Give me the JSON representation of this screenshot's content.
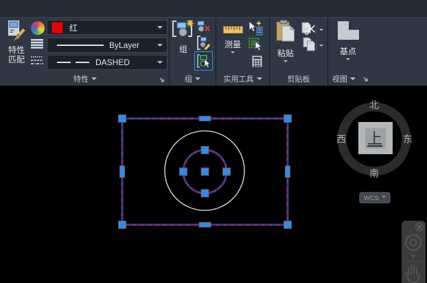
{
  "ribbon": {
    "properties_panel": {
      "label": "特性",
      "match_line1": "特性",
      "match_line2": "匹配",
      "color_value": "红",
      "lineweight_value": "ByLayer",
      "linetype_value": "DASHED"
    },
    "group_panel": {
      "label": "组",
      "group_button": "组"
    },
    "utilities_panel": {
      "label": "实用工具",
      "measure_button": "测量"
    },
    "clipboard_panel": {
      "label": "剪贴板",
      "paste_button": "粘贴"
    },
    "view_panel": {
      "label": "视图",
      "basepoint_button": "基点"
    }
  },
  "canvas": {
    "viewcube": {
      "north": "北",
      "south": "南",
      "east": "东",
      "west": "西",
      "top": "上"
    },
    "ucs_button": "WCS"
  },
  "colors": {
    "ribbon_bg": "#2e3743",
    "accent_blue": "#4a90d9",
    "swatch_red": "#ed0000",
    "selection_dash_red": "#c8203c",
    "selection_glow_blue": "#1e3f96",
    "grip_blue": "#2e8cf0",
    "canvas_bg": "#000000"
  },
  "icons": {
    "match_properties": "window-paintbrush-icon",
    "color_wheel": "color-wheel-icon",
    "lineweight": "lineweight-lines-icon",
    "linetype": "linetype-dashes-icon",
    "group": "group-objects-star-icon",
    "ungroup": "ungroup-red-x-icon",
    "group_edit": "group-edit-pencil-icon",
    "group_selection": "group-selection-cursor-icon",
    "measure": "ruler-icon",
    "quick_select": "cursor-lightning-list-icon",
    "select_similar": "green-dashed-rect-cursor-icon",
    "calculator": "calculator-icon",
    "paste": "clipboard-paste-icon",
    "cut": "scissors-document-icon",
    "copy": "copy-documents-icon",
    "base_point": "base-shape-icon",
    "viewcube": "compass-ring",
    "navigation_wheel": "navigation-wheel-icon",
    "pan": "pan-hand-icon",
    "close": "close-icon"
  }
}
